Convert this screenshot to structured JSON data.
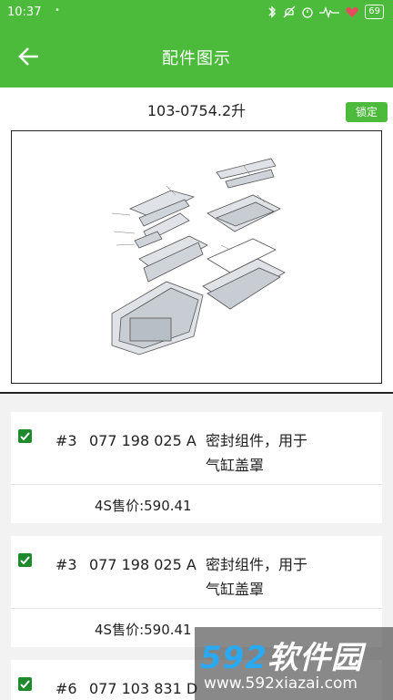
{
  "status_bar": {
    "time": "10:37",
    "dot": "•",
    "battery": "69"
  },
  "app_bar": {
    "title": "配件图示"
  },
  "subheader": {
    "model": "103-0754.2升",
    "lock_label": "锁定"
  },
  "parts": [
    {
      "checked": true,
      "index": "#3",
      "part_no": "077 198 025 A",
      "desc_line1": "密封组件，用于",
      "desc_line2": "气缸盖罩",
      "price": "4S售价:590.41"
    },
    {
      "checked": true,
      "index": "#3",
      "part_no": "077 198 025 A",
      "desc_line1": "密封组件，用于",
      "desc_line2": "气缸盖罩",
      "price": "4S售价:590.41"
    },
    {
      "checked": true,
      "index": "#6",
      "part_no": "077 103 831 D",
      "desc_line1": "",
      "desc_line2": "",
      "price": ""
    }
  ],
  "watermark": {
    "brand_num": "592",
    "brand_cn": "软件园",
    "url": "www.592xiazai.com"
  },
  "colors": {
    "primary": "#4cbb3c",
    "check": "#1d8a2b"
  }
}
